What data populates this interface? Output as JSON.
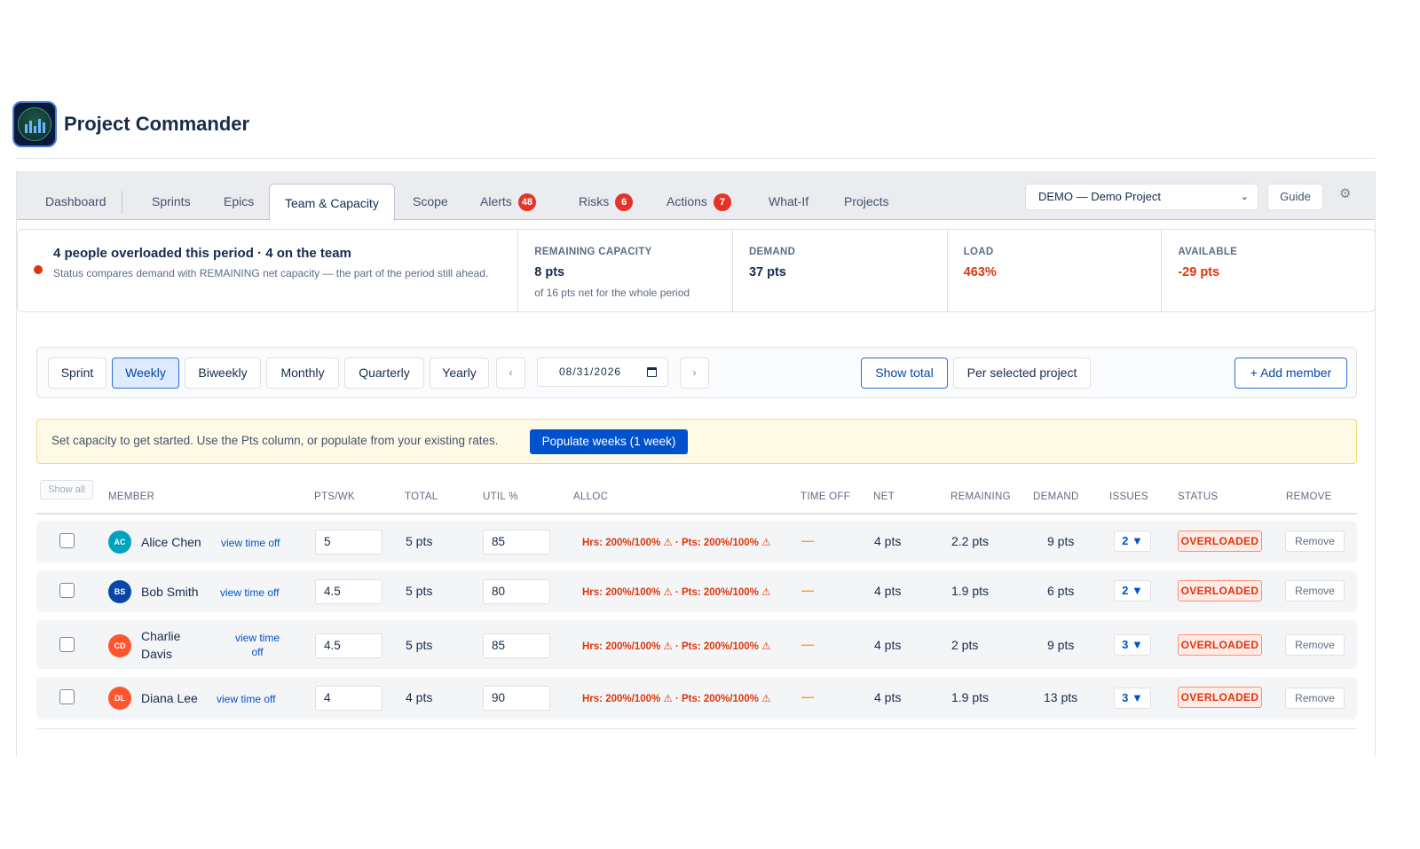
{
  "app": {
    "title": "Project Commander"
  },
  "tabs": [
    {
      "label": "Dashboard"
    },
    {
      "label": "Sprints"
    },
    {
      "label": "Epics"
    },
    {
      "label": "Team & Capacity",
      "active": true
    },
    {
      "label": "Scope"
    },
    {
      "label": "Alerts",
      "badge": "48"
    },
    {
      "label": "Risks",
      "badge": "6"
    },
    {
      "label": "Actions",
      "badge": "7"
    },
    {
      "label": "What-If"
    },
    {
      "label": "Projects"
    }
  ],
  "header_controls": {
    "project_select": "DEMO — Demo Project",
    "guide_label": "Guide",
    "settings_icon": "gear-icon"
  },
  "summary": {
    "title": "4 people overloaded this period · 4 on the team",
    "description": "Status compares demand with REMAINING net capacity — the part of the period still ahead.",
    "metrics": [
      {
        "label": "REMAINING CAPACITY",
        "value": "8 pts",
        "sub": "of 16 pts net for the whole period",
        "color": "#172b4d"
      },
      {
        "label": "DEMAND",
        "value": "37 pts",
        "sub": "",
        "color": "#172b4d"
      },
      {
        "label": "LOAD",
        "value": "463%",
        "sub": "",
        "color": "#de350b"
      },
      {
        "label": "AVAILABLE",
        "value": "-29 pts",
        "sub": "",
        "color": "#de350b"
      }
    ]
  },
  "period": {
    "options": [
      "Sprint",
      "Weekly",
      "Biweekly",
      "Monthly",
      "Quarterly",
      "Yearly"
    ],
    "selected": "Weekly",
    "prev_label": "‹",
    "next_label": "›",
    "date": "08/31/2026",
    "show_total_label": "Show total",
    "per_project_label": "Per selected project",
    "add_member_label": "+ Add member"
  },
  "banner": {
    "text": "Set capacity to get started. Use the Pts column, or populate from your existing rates.",
    "button_label": "Populate weeks (1 week)"
  },
  "table": {
    "show_all_label": "Show all",
    "headers": [
      "MEMBER",
      "PTS/WK",
      "TOTAL",
      "UTIL %",
      "ALLOC",
      "TIME OFF",
      "NET",
      "REMAINING",
      "DEMAND",
      "ISSUES",
      "STATUS",
      "REMOVE"
    ],
    "view_time_off_label": "view time off",
    "remove_label": "Remove",
    "rows": [
      {
        "initials": "AC",
        "name": "Alice Chen",
        "avatar_color": "#00a3bf",
        "pts_wk": "5",
        "total": "5 pts",
        "util": "85",
        "alloc": "Hrs: 200%/100% ⚠ · Pts: 200%/100% ⚠",
        "time_off": "—",
        "net": "4 pts",
        "remaining": "2.2 pts",
        "demand": "9 pts",
        "issues": "2 ▼",
        "status": "OVERLOADED"
      },
      {
        "initials": "BS",
        "name": "Bob Smith",
        "avatar_color": "#0747a6",
        "pts_wk": "4.5",
        "total": "5 pts",
        "util": "80",
        "alloc": "Hrs: 200%/100% ⚠ · Pts: 200%/100% ⚠",
        "time_off": "—",
        "net": "4 pts",
        "remaining": "1.9 pts",
        "demand": "6 pts",
        "issues": "2 ▼",
        "status": "OVERLOADED"
      },
      {
        "initials": "CD",
        "name": "Charlie Davis",
        "avatar_color": "#ff5630",
        "pts_wk": "4.5",
        "total": "5 pts",
        "util": "85",
        "alloc": "Hrs: 200%/100% ⚠ · Pts: 200%/100% ⚠",
        "time_off": "—",
        "net": "4 pts",
        "remaining": "2 pts",
        "demand": "9 pts",
        "issues": "3 ▼",
        "status": "OVERLOADED"
      },
      {
        "initials": "DL",
        "name": "Diana Lee",
        "avatar_color": "#ff5630",
        "pts_wk": "4",
        "total": "4 pts",
        "util": "90",
        "alloc": "Hrs: 200%/100% ⚠ · Pts: 200%/100% ⚠",
        "time_off": "—",
        "net": "4 pts",
        "remaining": "1.9 pts",
        "demand": "13 pts",
        "issues": "3 ▼",
        "status": "OVERLOADED"
      }
    ]
  }
}
